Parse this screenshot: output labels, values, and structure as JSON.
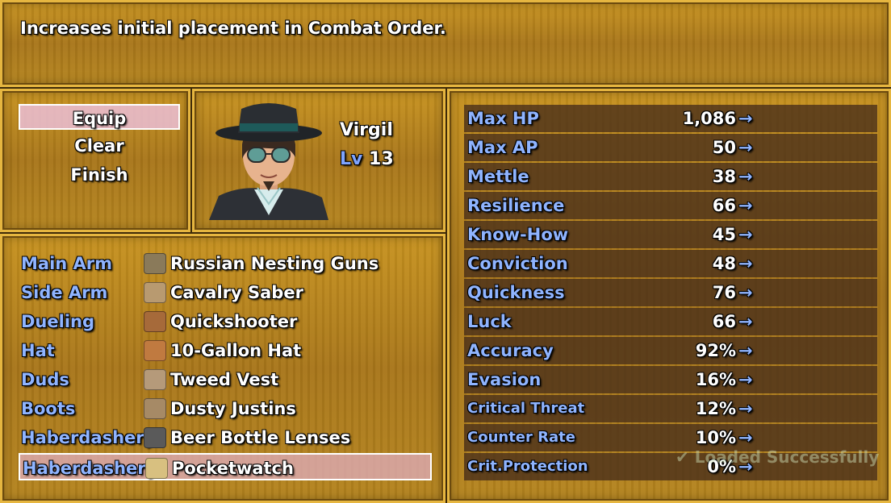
{
  "help": {
    "text": "Increases initial placement in Combat Order."
  },
  "commands": [
    {
      "label": "Equip",
      "selected": true
    },
    {
      "label": "Clear",
      "selected": false
    },
    {
      "label": "Finish",
      "selected": false
    }
  ],
  "actor": {
    "name": "Virgil",
    "level_label": "Lv",
    "level": "13",
    "portrait_icon": "virgil-portrait"
  },
  "equipment": [
    {
      "slot": "Main Arm",
      "item": "Russian Nesting Guns",
      "icon": "pistol-icon",
      "icon_color": "#8a7a5a"
    },
    {
      "slot": "Side Arm",
      "item": "Cavalry Saber",
      "icon": "saber-icon",
      "icon_color": "#b89a70"
    },
    {
      "slot": "Dueling",
      "item": "Quickshooter",
      "icon": "revolver-icon",
      "icon_color": "#a66a3a"
    },
    {
      "slot": "Hat",
      "item": "10-Gallon Hat",
      "icon": "hat-icon",
      "icon_color": "#c07a40"
    },
    {
      "slot": "Duds",
      "item": "Tweed Vest",
      "icon": "vest-icon",
      "icon_color": "#b59a7a"
    },
    {
      "slot": "Boots",
      "item": "Dusty Justins",
      "icon": "boots-icon",
      "icon_color": "#a68a66"
    },
    {
      "slot": "Haberdashery",
      "item": "Beer Bottle Lenses",
      "icon": "glasses-icon",
      "icon_color": "#5a5a5a"
    },
    {
      "slot": "Haberdashery",
      "item": "Pocketwatch",
      "icon": "pocketwatch-icon",
      "icon_color": "#d8c080",
      "selected": true
    }
  ],
  "stats": [
    {
      "label": "Max HP",
      "value": "1,086"
    },
    {
      "label": "Max AP",
      "value": "50"
    },
    {
      "label": "Mettle",
      "value": "38"
    },
    {
      "label": "Resilience",
      "value": "66"
    },
    {
      "label": "Know-How",
      "value": "45"
    },
    {
      "label": "Conviction",
      "value": "48"
    },
    {
      "label": "Quickness",
      "value": "76"
    },
    {
      "label": "Luck",
      "value": "66"
    },
    {
      "label": "Accuracy",
      "value": "92%"
    },
    {
      "label": "Evasion",
      "value": "16%"
    },
    {
      "label": "Critical Threat",
      "value": "12%",
      "small": true
    },
    {
      "label": "Counter Rate",
      "value": "10%",
      "small": true
    },
    {
      "label": "Crit.Protection",
      "value": "0%",
      "small": true
    }
  ],
  "arrow": "→",
  "toast": "✔ Loaded Successfully"
}
